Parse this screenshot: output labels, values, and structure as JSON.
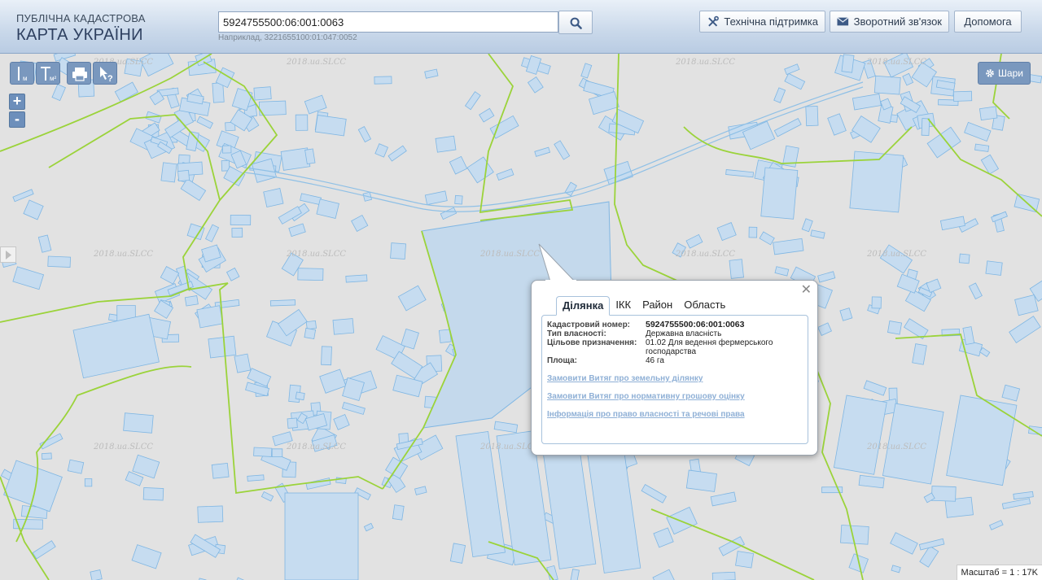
{
  "header": {
    "logo_line1": "ПУБЛІЧНА КАДАСТРОВА",
    "logo_line2": "КАРТА УКРАЇНИ",
    "search_value": "5924755500:06:001:0063",
    "search_hint": "Наприклад, 3221655100:01:047:0052",
    "buttons": {
      "tech_support": "Технічна підтримка",
      "feedback": "Зворотний зв'язок",
      "help": "Допомога"
    }
  },
  "map": {
    "layers_label": "Шари",
    "zoom_in": "+",
    "zoom_out": "-",
    "scale_text": "Масштаб = 1 : 17K",
    "watermark": "2018.ua.SLCC",
    "tools": {
      "measure_length_sub": "м",
      "measure_area_sub": "м²"
    },
    "colors": {
      "background": "#e2e2e2",
      "parcel_fill": "#c6dcf0",
      "parcel_stroke": "#7fb6e3",
      "boundary": "#9bd33a"
    }
  },
  "popup": {
    "tabs": [
      "Ділянка",
      "ІКК",
      "Район",
      "Область"
    ],
    "active_tab": "Ділянка",
    "fields": {
      "cadastral_label": "Кадастровий номер:",
      "cadastral_value": "5924755500:06:001:0063",
      "ownership_label": "Тип власності:",
      "ownership_value": "Державна власність",
      "purpose_label": "Цільове призначення:",
      "purpose_value": "01.02 Для ведення фермерського господарства",
      "area_label": "Площа:",
      "area_value": "46 га"
    },
    "links": {
      "order_extract": "Замовити Витяг про земельну ділянку",
      "order_valuation": "Замовити Витяг про нормативну грошову оцінку",
      "ownership_info": "Інформація про право власності та речові права"
    }
  }
}
